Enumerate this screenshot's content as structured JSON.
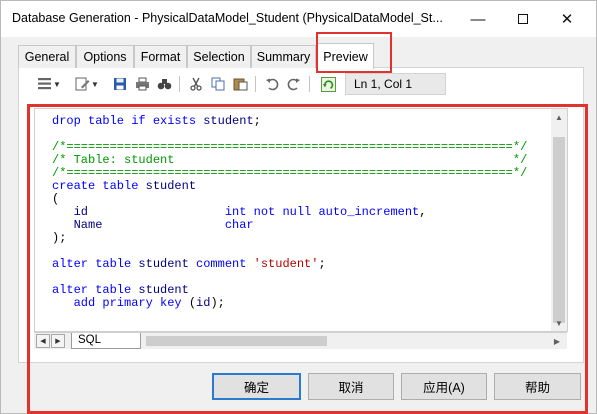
{
  "window": {
    "title": "Database Generation - PhysicalDataModel_Student (PhysicalDataModel_St...",
    "minimize_glyph": "—",
    "close_glyph": "✕"
  },
  "tabs": [
    {
      "label": "General"
    },
    {
      "label": "Options"
    },
    {
      "label": "Format"
    },
    {
      "label": "Selection"
    },
    {
      "label": "Summary"
    },
    {
      "label": "Preview",
      "active": true
    }
  ],
  "toolbar": {
    "cursor_position": "Ln 1, Col 1",
    "icons": [
      "properties-icon",
      "edit-icon",
      "save-icon",
      "print-icon",
      "find-icon",
      "cut-icon",
      "copy-icon",
      "paste-icon",
      "undo-icon",
      "redo-icon",
      "refresh-icon"
    ]
  },
  "editor": {
    "lines": [
      [
        {
          "t": "drop table if exists ",
          "c": "kw"
        },
        {
          "t": "student",
          "c": "id"
        },
        {
          "t": ";",
          "c": "nm"
        }
      ],
      [],
      [
        {
          "t": "/*==============================================================*/",
          "c": "cm"
        }
      ],
      [
        {
          "t": "/* Table: student                                               */",
          "c": "cm"
        }
      ],
      [
        {
          "t": "/*==============================================================*/",
          "c": "cm"
        }
      ],
      [
        {
          "t": "create table ",
          "c": "kw"
        },
        {
          "t": "student",
          "c": "id"
        }
      ],
      [
        {
          "t": "(",
          "c": "nm"
        }
      ],
      [
        {
          "t": "   id                   ",
          "c": "id"
        },
        {
          "t": "int not null auto_increment",
          "c": "kw"
        },
        {
          "t": ",",
          "c": "nm"
        }
      ],
      [
        {
          "t": "   Name                 ",
          "c": "id"
        },
        {
          "t": "char",
          "c": "kw"
        }
      ],
      [
        {
          "t": ");",
          "c": "nm"
        }
      ],
      [],
      [
        {
          "t": "alter table ",
          "c": "kw"
        },
        {
          "t": "student ",
          "c": "id"
        },
        {
          "t": "comment ",
          "c": "kw"
        },
        {
          "t": "'student'",
          "c": "st"
        },
        {
          "t": ";",
          "c": "nm"
        }
      ],
      [],
      [
        {
          "t": "alter table ",
          "c": "kw"
        },
        {
          "t": "student",
          "c": "id"
        }
      ],
      [
        {
          "t": "   add primary key ",
          "c": "kw"
        },
        {
          "t": "(",
          "c": "nm"
        },
        {
          "t": "id",
          "c": "id"
        },
        {
          "t": ");",
          "c": "nm"
        }
      ]
    ]
  },
  "sheet_tab": {
    "label": "SQL"
  },
  "buttons": {
    "ok": "确定",
    "cancel": "取消",
    "apply": "应用(A)",
    "help": "帮助"
  },
  "colors": {
    "highlight": "#e2322d",
    "keyword": "#0000ff",
    "comment": "#009900",
    "string": "#b60000",
    "identifier": "#000080",
    "default_button_border": "#2a7ad2"
  }
}
